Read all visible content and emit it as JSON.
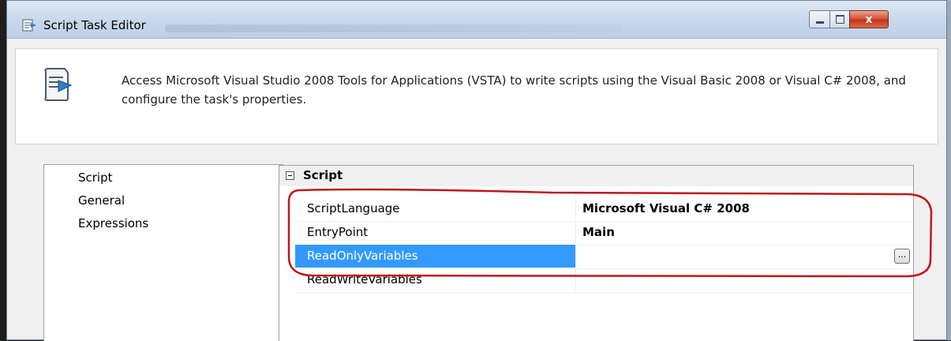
{
  "window": {
    "title": "Script Task Editor",
    "close_symbol": "x",
    "app_icon": "script-task-icon",
    "controls": [
      "minimize-icon",
      "maximize-icon",
      "close-icon"
    ]
  },
  "header": {
    "description": "Access Microsoft Visual Studio 2008 Tools for Applications (VSTA) to write scripts using the Visual Basic 2008 or Visual C# 2008, and configure the task's properties.",
    "icon": "script-task-large-icon"
  },
  "nav": {
    "items": [
      "Script",
      "General",
      "Expressions"
    ],
    "selected": "Script"
  },
  "properties": {
    "category": "Script",
    "expander_icon": "collapse-icon",
    "rows": [
      {
        "name": "ScriptLanguage",
        "value": "Microsoft Visual C# 2008"
      },
      {
        "name": "EntryPoint",
        "value": "Main"
      },
      {
        "name": "ReadOnlyVariables",
        "value": "",
        "selected": true
      },
      {
        "name": "ReadWriteVariables",
        "value": ""
      }
    ],
    "ellipsis_label": "..."
  },
  "colors": {
    "selection": "#3399ff",
    "annotation": "#c0161b",
    "close_button": "#c4341b"
  }
}
